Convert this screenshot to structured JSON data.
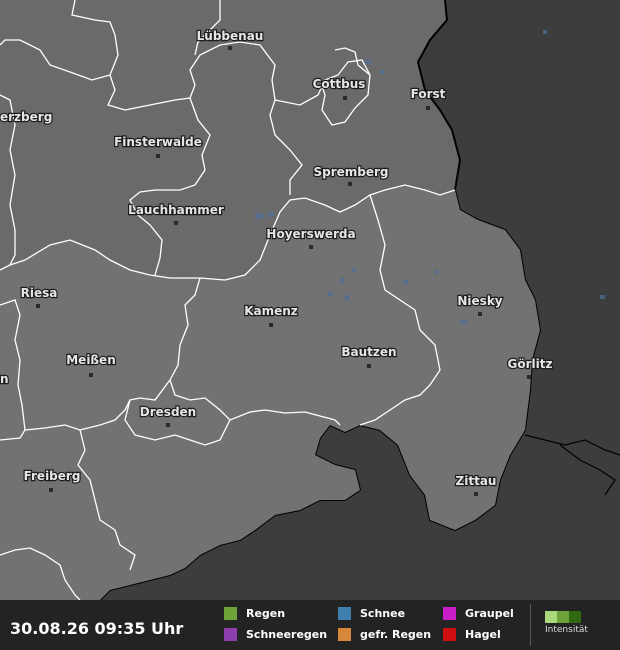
{
  "timestamp": "30.08.26 09:35 Uhr",
  "legend": {
    "items": [
      {
        "label": "Regen",
        "color": "#6ea33a"
      },
      {
        "label": "Schneeregen",
        "color": "#8e3fae"
      },
      {
        "label": "Schnee",
        "color": "#3f7fae"
      },
      {
        "label": "gefr. Regen",
        "color": "#d7873a"
      },
      {
        "label": "Graupel",
        "color": "#c81ec8"
      },
      {
        "label": "Hagel",
        "color": "#d01010"
      }
    ],
    "intensity_label": "Intensität",
    "intensity_colors": [
      "#a8d87a",
      "#6da33a",
      "#2f6a12"
    ]
  },
  "colors": {
    "outside_region": "#3d3d3d",
    "inside_region": "#6a6a6a",
    "boundary": "#ffffff",
    "country_border": "#000000"
  },
  "cities": [
    {
      "name": "Lübbenau"
    },
    {
      "name": "Cottbus"
    },
    {
      "name": "Forst"
    },
    {
      "name": "erzberg"
    },
    {
      "name": "Finsterwalde"
    },
    {
      "name": "Spremberg"
    },
    {
      "name": "Lauchhammer"
    },
    {
      "name": "Hoyerswerda"
    },
    {
      "name": "Riesa"
    },
    {
      "name": "Niesky"
    },
    {
      "name": "Kamenz"
    },
    {
      "name": "Bautzen"
    },
    {
      "name": "Meißen"
    },
    {
      "name": "Görlitz"
    },
    {
      "name": "n"
    },
    {
      "name": "Dresden"
    },
    {
      "name": "Freiberg"
    },
    {
      "name": "Zittau"
    }
  ]
}
